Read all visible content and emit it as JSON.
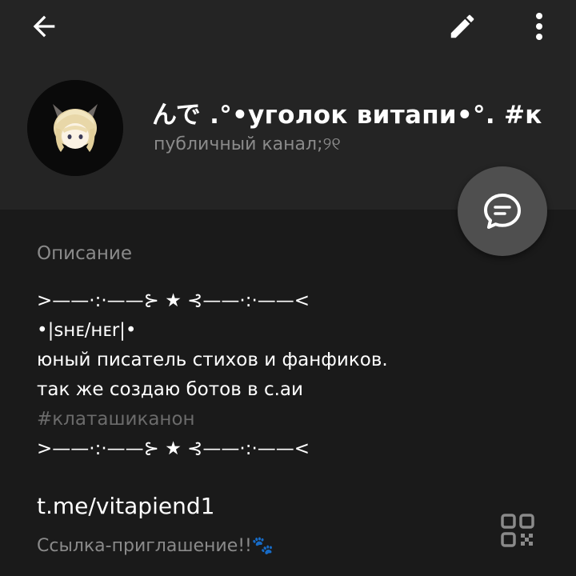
{
  "toolbar": {
    "back_icon": "arrow-left-icon",
    "edit_icon": "pencil-icon",
    "more_icon": "more-vertical-icon"
  },
  "profile": {
    "title": "んで .°•уголок витапи•°. #к",
    "subtitle": "публичный канал;୨୧",
    "avatar_icon": "avatar-image"
  },
  "fab": {
    "icon": "message-bubble-icon"
  },
  "description": {
    "label": "Описание",
    "lines": [
      ">——·:·——⊱ ★ ⊰——·:·——<",
      "•|sʜᴇ/ʜᴇr|•",
      "юный писатель стихов и фанфиков.",
      "так же создаю ботов в с.аи",
      "#клаташиканон",
      ">——·:·——⊱ ★ ⊰——·:·——<"
    ]
  },
  "link": {
    "url": "t.me/vitapiend1",
    "label": "Ссылка-приглашение!!🐾",
    "qr_icon": "qr-code-icon"
  },
  "colors": {
    "background": "#1a1a1a",
    "header_background": "#242424",
    "fab_background": "#4f4f4f",
    "secondary_text": "#8a8a8a",
    "hashtag_text": "#6b6b6b"
  }
}
